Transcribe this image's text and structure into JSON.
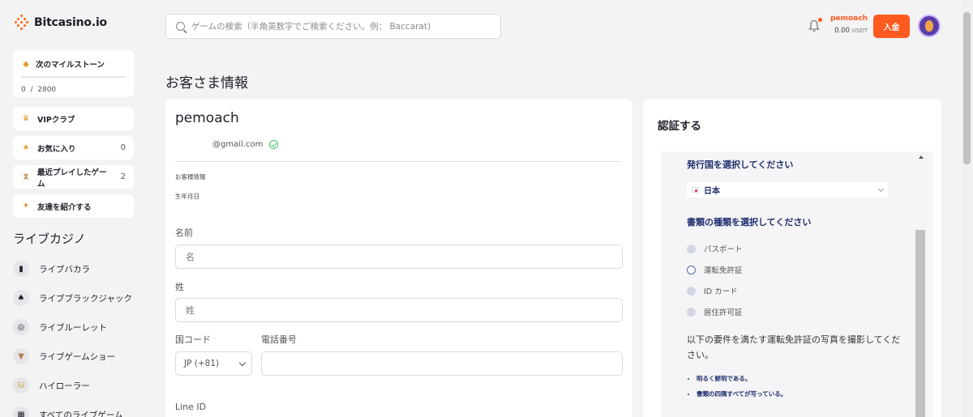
{
  "brand": {
    "name": "Bitcasino.io",
    "accent": "#ff6a13"
  },
  "sidebar": {
    "milestone": {
      "label": "次のマイルストーン",
      "current": "0",
      "separator": "/",
      "target": "2800",
      "progress": 0
    },
    "items": [
      {
        "label": "VIPクラブ",
        "count": "",
        "icon": "crown-icon"
      },
      {
        "label": "お気に入り",
        "count": "0",
        "icon": "star-icon"
      },
      {
        "label": "最近プレイしたゲーム",
        "count": "2",
        "icon": "hourglass-icon"
      },
      {
        "label": "友達を紹介する",
        "count": "",
        "icon": "megaphone-icon"
      }
    ],
    "section_title": "ライブカジノ",
    "live_items": [
      {
        "label": "ライブバカラ",
        "icon": "card-icon"
      },
      {
        "label": "ライブブラックジャック",
        "icon": "spade-icon"
      },
      {
        "label": "ライブルーレット",
        "icon": "roulette-icon"
      },
      {
        "label": "ライブゲームショー",
        "icon": "gameshow-icon"
      },
      {
        "label": "ハイローラー",
        "icon": "chips-icon"
      },
      {
        "label": "すべてのライブゲーム",
        "icon": "grid-icon"
      }
    ]
  },
  "header": {
    "search_placeholder": "ゲームの検索（半角英数字でご検索ください。例： Baccarat)",
    "username": "pemoach",
    "balance": "0.00",
    "currency": "USDT",
    "deposit_label": "入金"
  },
  "page": {
    "title": "お客さま情報"
  },
  "profile": {
    "username": "pemoach",
    "email": "@gmail.com",
    "customer_info_label": "お客様情報",
    "birthdate_label": "生年月日",
    "first_name_label": "名前",
    "first_name_placeholder": "名",
    "last_name_label": "姓",
    "last_name_placeholder": "姓",
    "country_code_label": "国コード",
    "country_code_value": "JP (+81)",
    "phone_label": "電話番号",
    "line_id_label": "Line ID"
  },
  "verify": {
    "title": "認証する",
    "country_heading": "発行国を選択してください",
    "country_value": "日本",
    "doc_heading": "書類の種類を選択してください",
    "doc_options": [
      {
        "label": "パスポート",
        "selected": false
      },
      {
        "label": "運転免許証",
        "selected": true
      },
      {
        "label": "ID カード",
        "selected": false
      },
      {
        "label": "居住許可証",
        "selected": false
      }
    ],
    "description": "以下の要件を満たす運転免許証の写真を撮影してください。",
    "requirements": [
      "明るく鮮明である。",
      "書類の四隅すべてが写っている。"
    ]
  }
}
